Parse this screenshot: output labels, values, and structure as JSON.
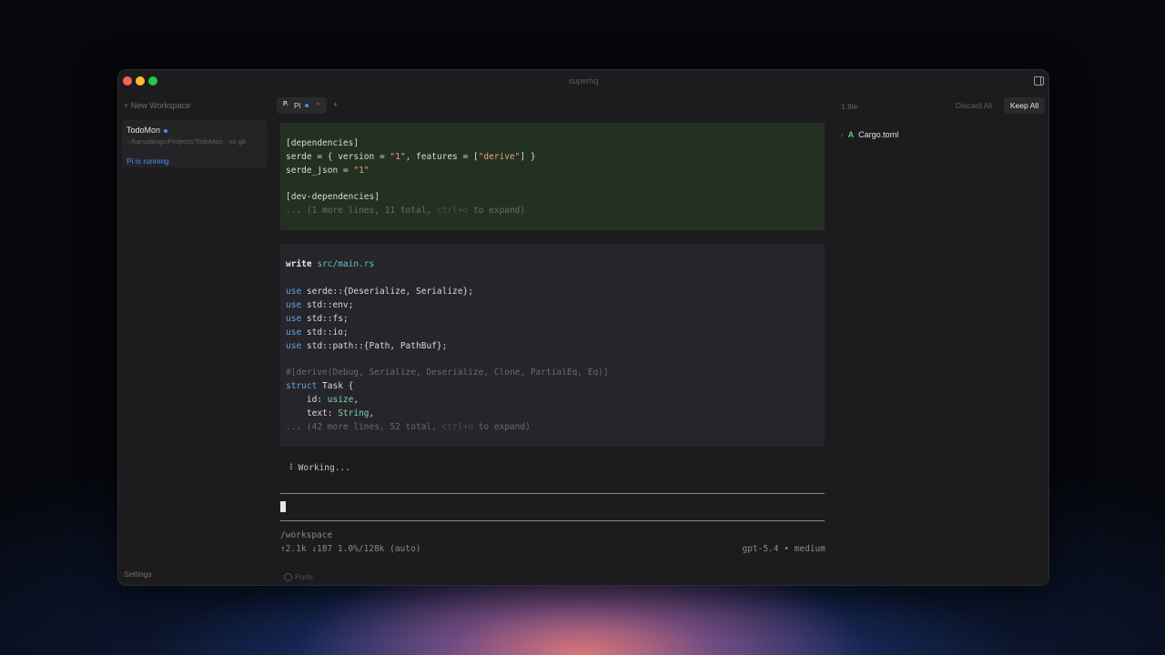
{
  "window": {
    "title": "superhq"
  },
  "sidebar": {
    "new_workspace": "+ New Workspace",
    "workspace": {
      "name": "TodoMon",
      "path": "~/harsobingo/Projects/TodoMon · no git",
      "status": "Pi is running"
    },
    "settings": "Settings"
  },
  "tabs": {
    "active": {
      "icon": "P.",
      "label": "Pi",
      "close": "×"
    },
    "add": "+"
  },
  "block1": {
    "lines": [
      "[dependencies]",
      "serde = { version = \"1\", features = [\"derive\"] }",
      "serde_json = \"1\"",
      "",
      "[dev-dependencies]",
      "... (1 more lines, 11 total, ctrl+o to expand)"
    ]
  },
  "block2": {
    "header_cmd": "write",
    "header_path": "src/main.rs",
    "lines": [
      "use serde::{Deserialize, Serialize};",
      "use std::env;",
      "use std::fs;",
      "use std::io;",
      "use std::path::{Path, PathBuf};",
      "",
      "#[derive(Debug, Serialize, Deserialize, Clone, PartialEq, Eq)]",
      "struct Task {",
      "    id: usize,",
      "    text: String,",
      "... (42 more lines, 52 total, ctrl+o to expand)"
    ]
  },
  "status": {
    "working": "⠸ Working...",
    "cwd": "/workspace",
    "tokens": "↑2.1k ↓187 1.0%/128k (auto)",
    "model": "gpt-5.4 • medium",
    "ports": "Ports"
  },
  "files_panel": {
    "count": "1 file",
    "discard_all": "Discard All",
    "keep_all": "Keep All",
    "files": [
      {
        "badge": "A",
        "name": "Cargo.toml"
      }
    ]
  },
  "colors": {
    "accent": "#4b8df8",
    "added": "#6cc070",
    "green_block_bg": "#233122",
    "code_block_bg": "#26262a"
  },
  "icons": [
    "sidebar-toggle-icon",
    "chevron-icon",
    "ports-icon"
  ]
}
